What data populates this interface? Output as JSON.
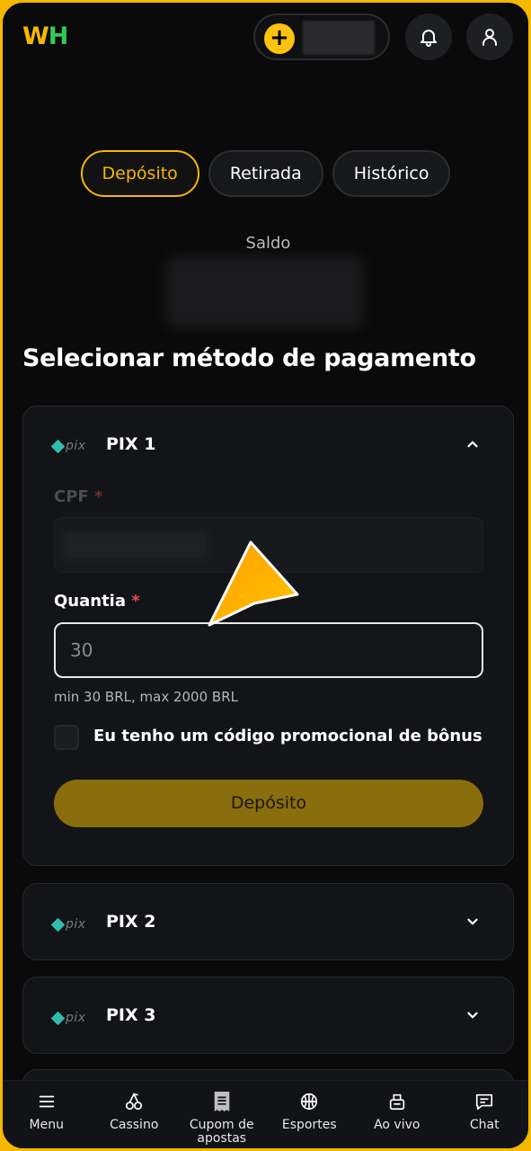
{
  "header": {
    "logo_w": "W",
    "logo_h": "H",
    "plus_label": "+",
    "icons": [
      "bell-icon",
      "user-icon"
    ]
  },
  "tabs": [
    {
      "label": "Depósito",
      "active": true
    },
    {
      "label": "Retirada",
      "active": false
    },
    {
      "label": "Histórico",
      "active": false
    }
  ],
  "balance": {
    "label": "Saldo"
  },
  "section_title": "Selecionar método de pagamento",
  "methods": [
    {
      "logo_text": "pix",
      "title": "PIX 1",
      "expanded": true,
      "form": {
        "cpf_label": "CPF",
        "required_mark": "*",
        "amount_label": "Quantia",
        "amount_placeholder": "30",
        "hint": "min 30 BRL, max 2000 BRL",
        "promo_label": "Eu tenho um código promocional de bônus",
        "submit_label": "Depósito"
      }
    },
    {
      "logo_text": "pix",
      "title": "PIX 2",
      "expanded": false
    },
    {
      "logo_text": "pix",
      "title": "PIX 3",
      "expanded": false
    }
  ],
  "bottom_nav": [
    {
      "label": "Menu",
      "icon": "menu-icon"
    },
    {
      "label": "Cassino",
      "icon": "cherries-icon"
    },
    {
      "label": "Cupom de apostas",
      "icon": "receipt-icon"
    },
    {
      "label": "Esportes",
      "icon": "basketball-icon"
    },
    {
      "label": "Ao vivo",
      "icon": "live-icon"
    },
    {
      "label": "Chat",
      "icon": "chat-icon"
    }
  ],
  "colors": {
    "accent": "#f5b800",
    "required": "#e5484d",
    "pix": "#32bcad",
    "submit_disabled": "#8a6d0d"
  }
}
